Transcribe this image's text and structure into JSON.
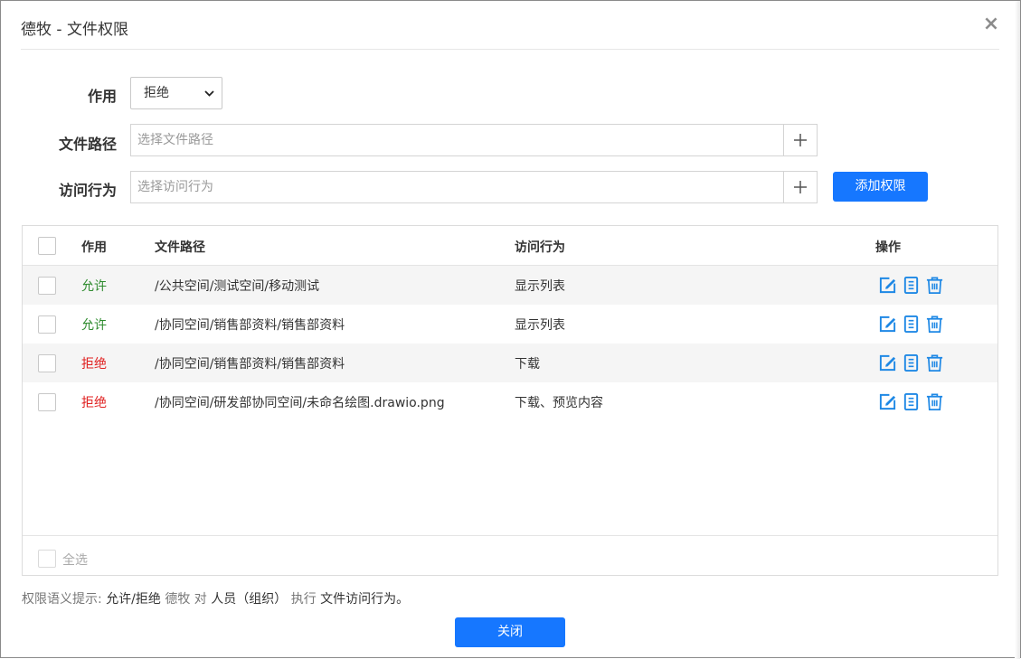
{
  "dialog": {
    "title": "德牧 - 文件权限",
    "close_glyph": "×"
  },
  "form": {
    "effect_label": "作用",
    "effect_value": "拒绝",
    "path_label": "文件路径",
    "path_placeholder": "选择文件路径",
    "action_label": "访问行为",
    "action_placeholder": "选择访问行为",
    "plus_glyph": "+",
    "add_button": "添加权限"
  },
  "table": {
    "headers": {
      "effect": "作用",
      "path": "文件路径",
      "action": "访问行为",
      "ops": "操作"
    },
    "rows": [
      {
        "effect": "允许",
        "effect_type": "allow",
        "path": "/公共空间/测试空间/移动测试",
        "action": "显示列表"
      },
      {
        "effect": "允许",
        "effect_type": "allow",
        "path": "/协同空间/销售部资料/销售部资料",
        "action": "显示列表"
      },
      {
        "effect": "拒绝",
        "effect_type": "deny",
        "path": "/协同空间/销售部资料/销售部资料",
        "action": "下载"
      },
      {
        "effect": "拒绝",
        "effect_type": "deny",
        "path": "/协同空间/研发部协同空间/未命名绘图.drawio.png",
        "action": "下载、预览内容"
      }
    ],
    "select_all": "全选",
    "icons": [
      "edit-icon",
      "detail-icon",
      "delete-icon"
    ]
  },
  "hint": {
    "p1": "权限语义提示:",
    "p2": "允许/拒绝",
    "p3": "德牧",
    "p4": "对",
    "p5": "人员（组织）",
    "p6": "执行",
    "p7": "文件访问行为。"
  },
  "footer": {
    "close_button": "关闭"
  },
  "colors": {
    "primary": "#1677ff",
    "allow": "#2e8b2e",
    "deny": "#e02020",
    "icon": "#1e88e5"
  }
}
